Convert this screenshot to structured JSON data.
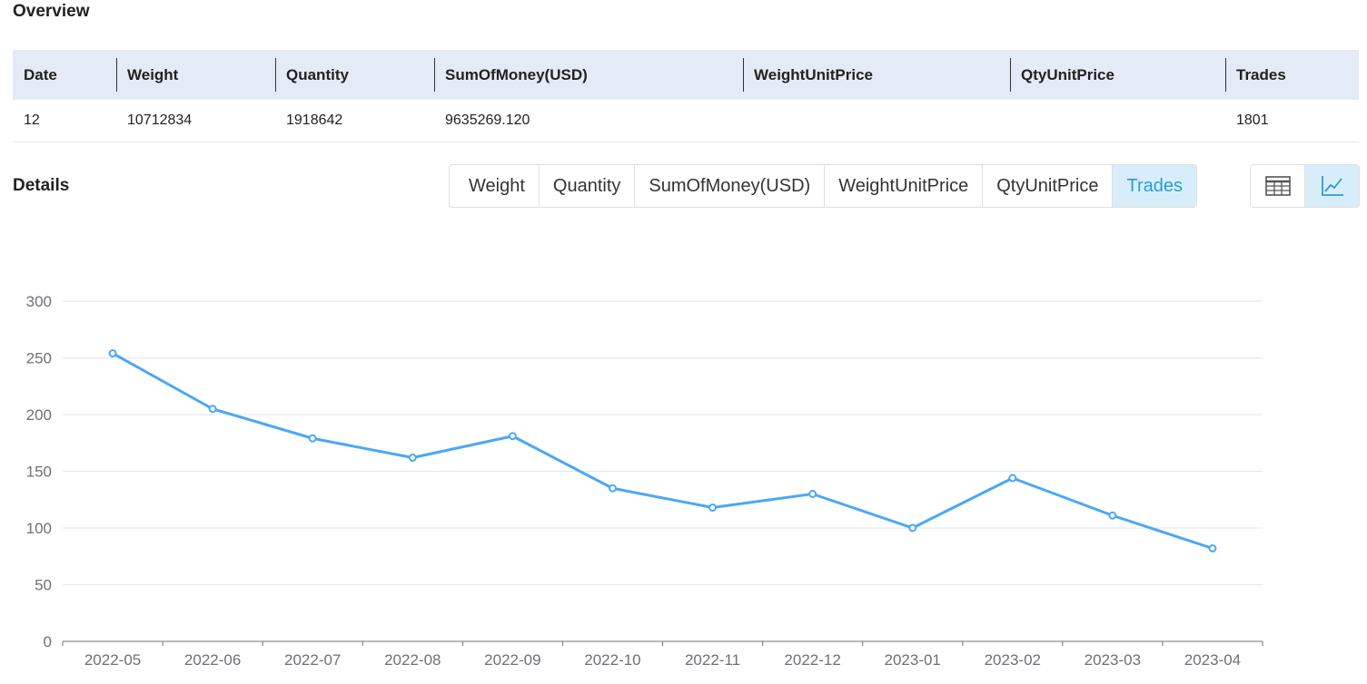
{
  "overview": {
    "title": "Overview",
    "columns": [
      "Date",
      "Weight",
      "Quantity",
      "SumOfMoney(USD)",
      "WeightUnitPrice",
      "QtyUnitPrice",
      "Trades"
    ],
    "row": [
      "12",
      "10712834",
      "1918642",
      "9635269.120",
      "",
      "",
      "1801"
    ]
  },
  "details": {
    "title": "Details",
    "tabs": [
      "Weight",
      "Quantity",
      "SumOfMoney(USD)",
      "WeightUnitPrice",
      "QtyUnitPrice",
      "Trades"
    ],
    "active_tab": "Trades",
    "view_toggle": [
      {
        "icon": "table-icon",
        "active": false
      },
      {
        "icon": "line-chart-icon",
        "active": true
      }
    ]
  },
  "colors": {
    "accent": "#2b9bd7",
    "series": "#4ba7f5",
    "header_bg": "#e4eaf6",
    "active_bg": "#d7eefa"
  },
  "chart_data": {
    "type": "line",
    "categories": [
      "2022-05",
      "2022-06",
      "2022-07",
      "2022-08",
      "2022-09",
      "2022-10",
      "2022-11",
      "2022-12",
      "2023-01",
      "2023-02",
      "2023-03",
      "2023-04"
    ],
    "series": [
      {
        "values": [
          254,
          205,
          179,
          162,
          181,
          135,
          118,
          130,
          100,
          144,
          111,
          82
        ]
      }
    ],
    "yticks": [
      0,
      50,
      100,
      150,
      200,
      250,
      300
    ],
    "ylim": [
      0,
      300
    ],
    "grid": true,
    "legend": "none"
  }
}
